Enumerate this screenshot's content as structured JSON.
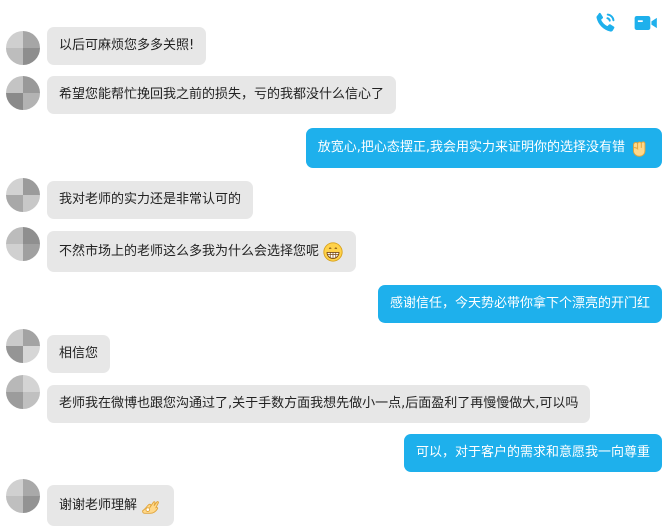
{
  "toolbar": {
    "phone_icon": "phone-icon",
    "video_icon": "video-camera-icon",
    "accent": "#1eb0ec"
  },
  "messages": [
    {
      "side": "in",
      "text": "以后可麻烦您多多关照!"
    },
    {
      "side": "in",
      "text": "希望您能帮忙挽回我之前的损失，亏的我都没什么信心了"
    },
    {
      "side": "out",
      "text": "放宽心,把心态摆正,我会用实力来证明你的选择没有错",
      "emoji": "fist-emoji"
    },
    {
      "side": "in",
      "text": "我对老师的实力还是非常认可的"
    },
    {
      "side": "in",
      "text": "不然市场上的老师这么多我为什么会选择您呢",
      "emoji": "grin-emoji"
    },
    {
      "side": "out",
      "text": "感谢信任，今天势必带你拿下个漂亮的开门红"
    },
    {
      "side": "in",
      "text": "相信您"
    },
    {
      "side": "in",
      "text": "老师我在微博也跟您沟通过了,关于手数方面我想先做小一点,后面盈利了再慢慢做大,可以吗"
    },
    {
      "side": "out",
      "text": "可以，对于客户的需求和意愿我一向尊重"
    },
    {
      "side": "in",
      "text": "谢谢老师理解",
      "emoji": "ok-hand-emoji"
    }
  ]
}
